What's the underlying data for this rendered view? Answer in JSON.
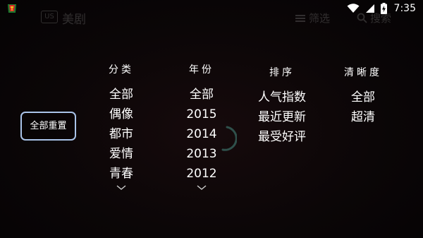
{
  "status_bar": {
    "time": "7:35",
    "icons": [
      "wifi-icon",
      "signal-icon",
      "battery-charging-icon"
    ],
    "app_icon": "app-notification-icon"
  },
  "header": {
    "logo_text": "US",
    "title": "美剧",
    "filter_label": "筛选",
    "search_label": "搜索"
  },
  "reset_button": {
    "label": "全部重置"
  },
  "columns": [
    {
      "heading": "分类",
      "options": [
        "全部",
        "偶像",
        "都市",
        "爱情",
        "青春"
      ],
      "has_more": true
    },
    {
      "heading": "年份",
      "options": [
        "全部",
        "2015",
        "2014",
        "2013",
        "2012"
      ],
      "has_more": true
    },
    {
      "heading": "排序",
      "options": [
        "人气指数",
        "最近更新",
        "最受好评"
      ],
      "has_more": false
    },
    {
      "heading": "清晰度",
      "options": [
        "全部",
        "超清"
      ],
      "has_more": false
    }
  ],
  "colors": {
    "background": "#0b0607",
    "text": "#ffffff",
    "reset_border": "#a9c3e8",
    "spinner": "#3a6f66"
  }
}
